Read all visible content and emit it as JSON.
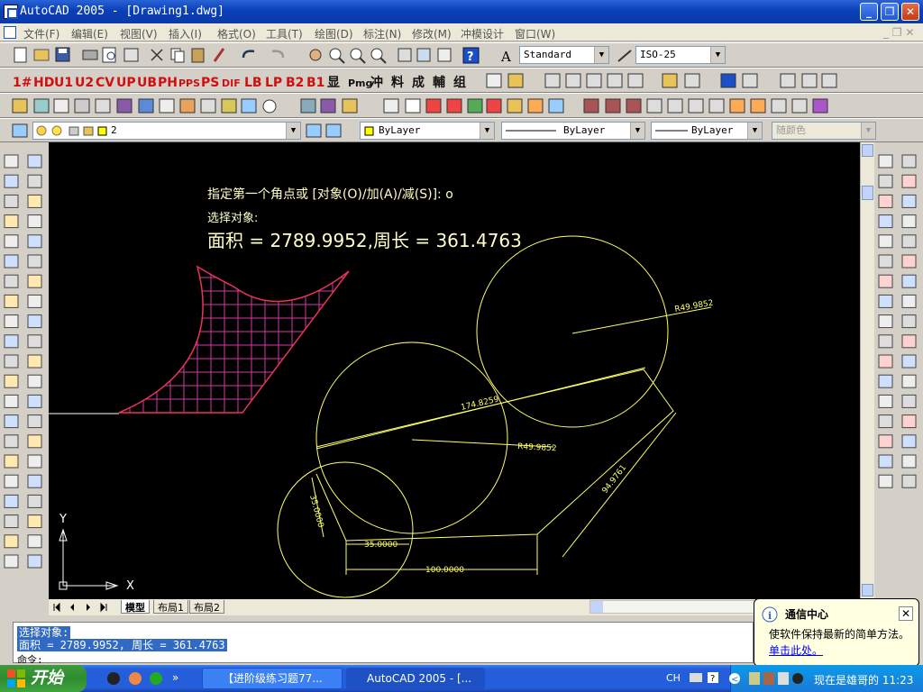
{
  "window": {
    "title": "AutoCAD 2005 - [Drawing1.dwg]",
    "minimize": "_",
    "restore": "❐",
    "close": "✕"
  },
  "menu": [
    "文件(F)",
    "编辑(E)",
    "视图(V)",
    "插入(I)",
    "格式(O)",
    "工具(T)",
    "绘图(D)",
    "标注(N)",
    "修改(M)",
    "冲模设计",
    "窗口(W)"
  ],
  "toolbar": {
    "text_style": "Standard",
    "dim_style": "ISO-25",
    "custom_buttons": [
      "1#",
      "HD",
      "U1",
      "U2",
      "CV",
      "UP",
      "UB",
      "PH",
      "PPS",
      "PS",
      "DIF",
      "LB",
      "LP",
      "B2",
      "B1",
      "显",
      "Pmg",
      "冲",
      "料",
      "成",
      "輔",
      "组"
    ],
    "layer": "2",
    "color": "ByLayer",
    "linetype": "ByLayer",
    "lineweight": "ByLayer",
    "plotstyle": "随颜色"
  },
  "canvas": {
    "prompt1": "指定第一个角点或 [对象(O)/加(A)/减(S)]: o",
    "prompt2": "选择对象:",
    "result": "面积 = 2789.9952,周长 = 361.4763",
    "dims": {
      "r1": "R49.9852",
      "r2": "R49.9852",
      "len1": "174.8259",
      "len2": "94.9761",
      "len3": "35.0000",
      "len4": "100.0000",
      "len5": "35.0000"
    },
    "ucs_x": "X",
    "ucs_y": "Y"
  },
  "layout_tabs": [
    "模型",
    "布局1",
    "布局2"
  ],
  "command": {
    "line1": "选择对象:",
    "line2": "面积 = 2789.9952, 周长 = 361.4763",
    "line3": "命令:"
  },
  "notification": {
    "title": "通信中心",
    "body": "使软件保持最新的简单方法。",
    "link": "单击此处。"
  },
  "taskbar": {
    "start": "开始",
    "tasks": [
      "【进阶级练习题77...",
      "AutoCAD 2005 - [..."
    ],
    "ime": "CH",
    "tray_text": "现在是雄哥的 11:23"
  },
  "colors": {
    "canvas_bg": "#000000",
    "geometry": "#ffff66",
    "hatch": "#d23aa0",
    "text": "#ffffff",
    "hatch_edge": "#e8325a"
  }
}
